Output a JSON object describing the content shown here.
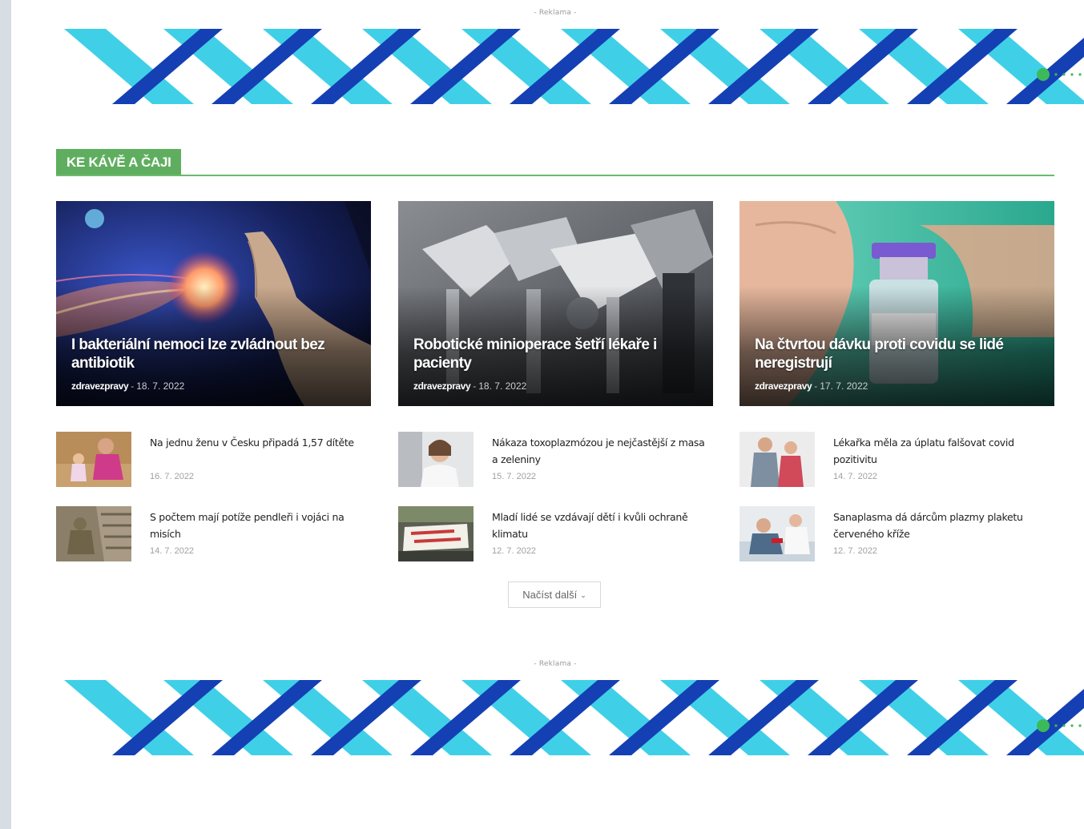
{
  "ads": {
    "top_label": "- Reklama -",
    "bottom_label": "- Reklama -"
  },
  "section": {
    "title": "Ke kávě a čaji"
  },
  "colors": {
    "accent": "#5fae5f",
    "helix_light": "#3fd0e8",
    "helix_dark": "#1440b4",
    "dots": "#3cba5a"
  },
  "featured": [
    {
      "title": "I bakteriální nemoci lze zvládnout bez antibiotik",
      "author": "zdravezpravy",
      "separator": "-",
      "date": "18. 7. 2022"
    },
    {
      "title": "Robotické minioperace šetří lékaře i pacienty",
      "author": "zdravezpravy",
      "separator": "-",
      "date": "18. 7. 2022"
    },
    {
      "title": "Na čtvrtou dávku proti covidu se lidé neregistrují",
      "author": "zdravezpravy",
      "separator": "-",
      "date": "17. 7. 2022"
    }
  ],
  "items": [
    {
      "title": "Na jednu ženu v Česku připadá 1,57 dítěte",
      "date": "16. 7. 2022"
    },
    {
      "title": "Nákaza toxoplazmózou je nejčastější z masa a zeleniny",
      "date": "15. 7. 2022"
    },
    {
      "title": "Lékařka měla za úplatu falšovat covid pozitivitu",
      "date": "14. 7. 2022"
    },
    {
      "title": "S počtem mají potíže pendleři i vojáci na misích",
      "date": "14. 7. 2022"
    },
    {
      "title": "Mladí lidé se vzdávají dětí i kvůli ochraně klimatu",
      "date": "12. 7. 2022"
    },
    {
      "title": "Sanaplasma dá dárcům plazmy plaketu červeného kříže",
      "date": "12. 7. 2022"
    }
  ],
  "load_more": {
    "label": "Načíst další"
  }
}
